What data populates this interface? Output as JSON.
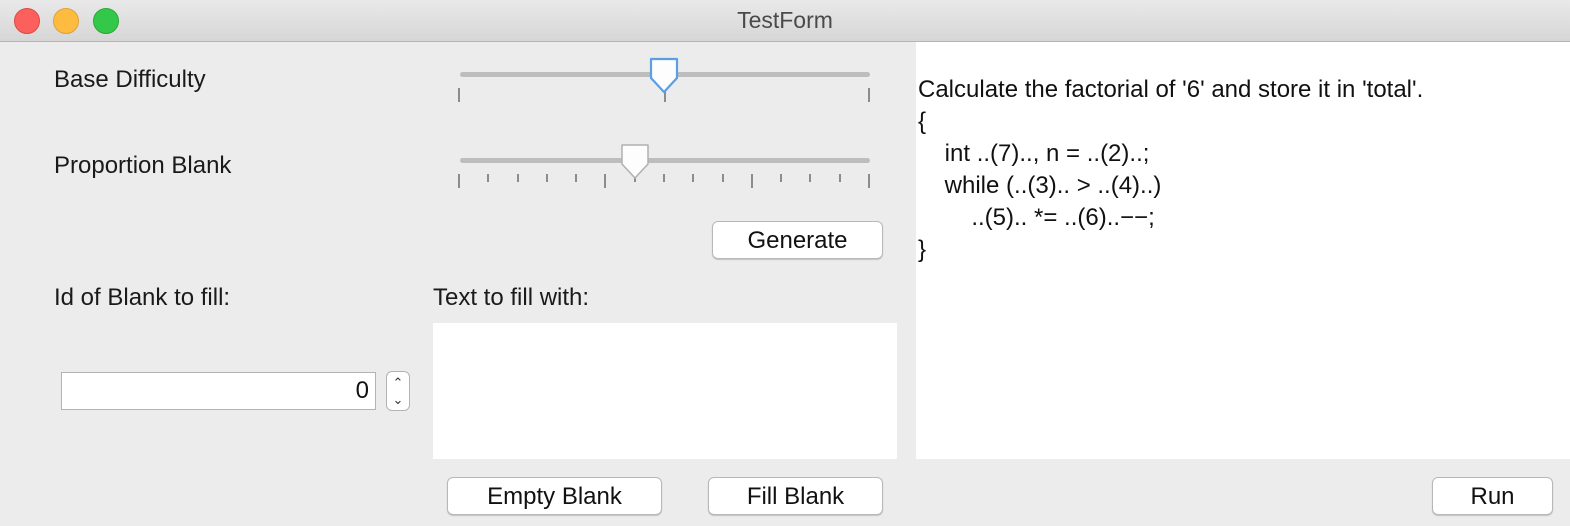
{
  "window": {
    "title": "TestForm"
  },
  "controls": {
    "base_difficulty_label": "Base Difficulty",
    "base_difficulty_value": 0.5,
    "proportion_blank_label": "Proportion Blank",
    "proportion_blank_value": 0.43,
    "generate_label": "Generate",
    "blank_id_label": "Id of Blank to fill:",
    "blank_id_value": "0",
    "fill_text_label": "Text to fill with:",
    "fill_text_value": "",
    "empty_blank_label": "Empty Blank",
    "fill_blank_label": "Fill Blank",
    "run_label": "Run"
  },
  "code": {
    "lines": [
      "Calculate the factorial of '6' and store it in 'total'.",
      "{",
      "    int ..(7).., n = ..(2)..;",
      "    while (..(3).. > ..(4)..)",
      "        ..(5).. *= ..(6)..−−;",
      "}"
    ]
  }
}
